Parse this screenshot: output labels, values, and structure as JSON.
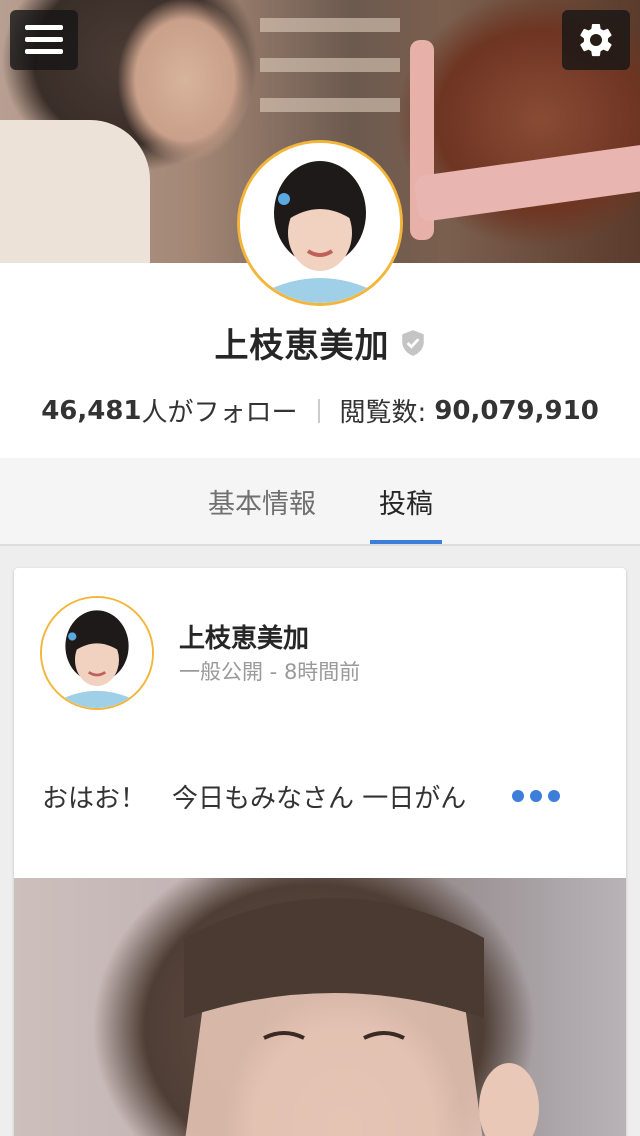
{
  "colors": {
    "accent": "#3d7edb",
    "avatar_ring": "#f3b63a",
    "text_dark": "#262626",
    "text_muted": "#9a9a9a",
    "tab_bg": "#f5f5f5",
    "page_bg": "#eeeeee"
  },
  "top_bar": {
    "menu_icon": "hamburger-menu-icon",
    "settings_icon": "gear-icon"
  },
  "profile": {
    "name": "上枝恵美加",
    "verified_icon": "verified-shield-icon",
    "followers_count": "46,481",
    "followers_label": "人がフォロー",
    "views_label": "閲覧数:",
    "views_count": "90,079,910"
  },
  "tabs": [
    {
      "label": "基本情報",
      "active": false
    },
    {
      "label": "投稿",
      "active": true
    }
  ],
  "post": {
    "author": "上枝恵美加",
    "visibility": "一般公開",
    "separator": " - ",
    "time": "8時間前",
    "text": "おはお！　今日もみなさん 一日がん",
    "more_icon": "more-dots-icon"
  }
}
